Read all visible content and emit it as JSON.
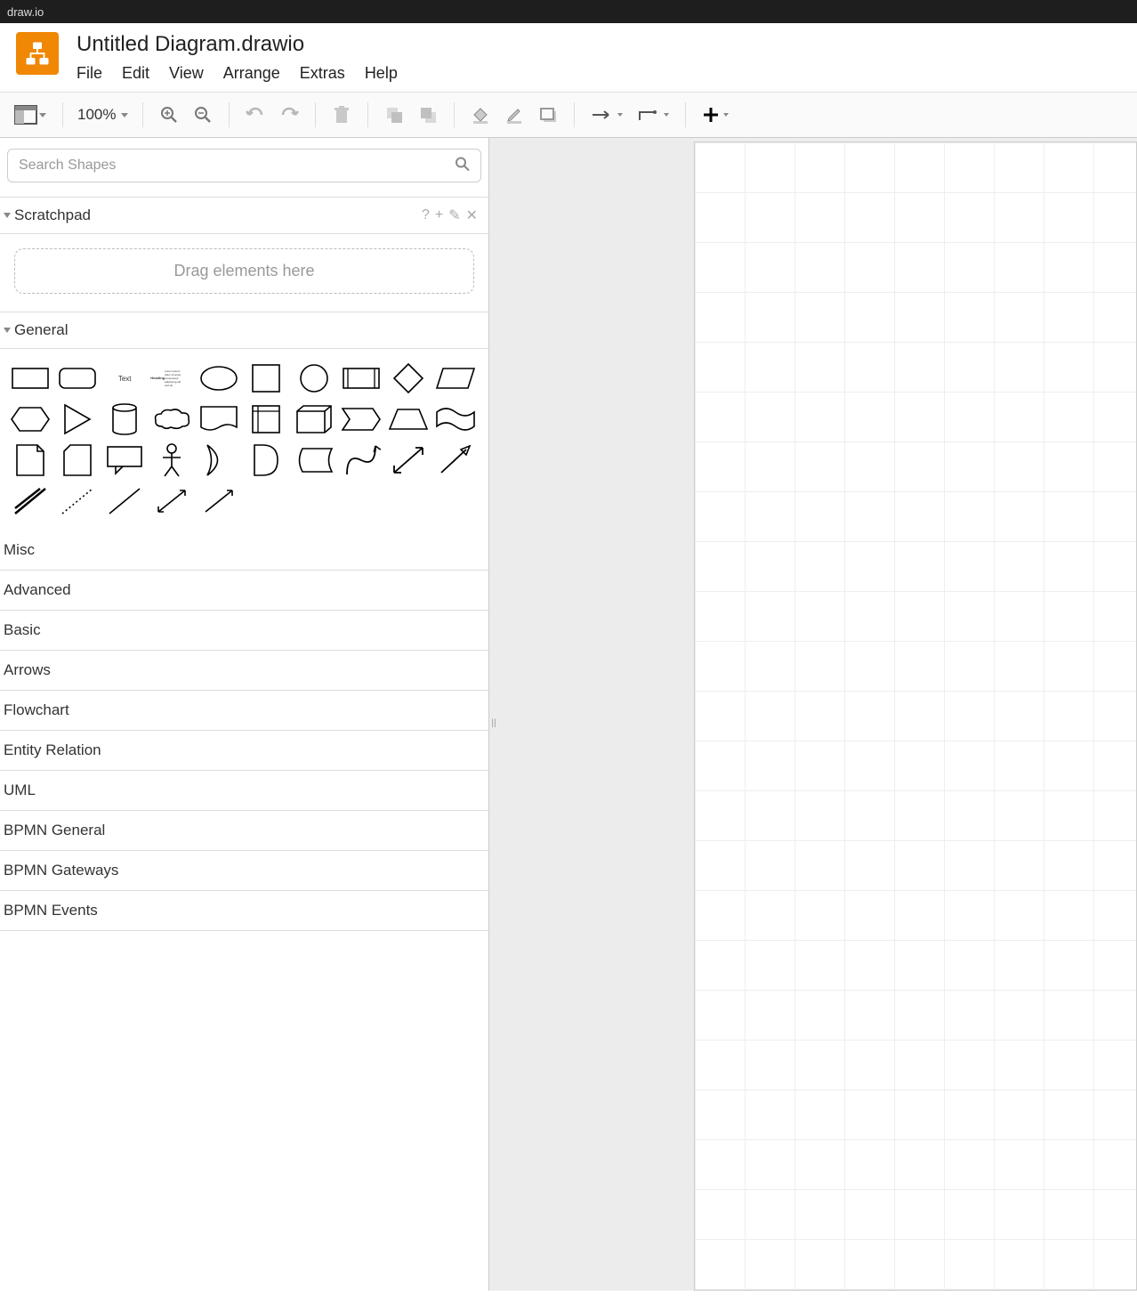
{
  "app_title": "draw.io",
  "doc_title": "Untitled Diagram.drawio",
  "menu": [
    "File",
    "Edit",
    "View",
    "Arrange",
    "Extras",
    "Help"
  ],
  "toolbar": {
    "zoom": "100%"
  },
  "search": {
    "placeholder": "Search Shapes"
  },
  "scratchpad": {
    "title": "Scratchpad",
    "drop_hint": "Drag elements here"
  },
  "general": {
    "title": "General",
    "text_label": "Text",
    "heading_label": "Heading"
  },
  "categories": [
    "Misc",
    "Advanced",
    "Basic",
    "Arrows",
    "Flowchart",
    "Entity Relation",
    "UML",
    "BPMN General",
    "BPMN Gateways",
    "BPMN Events"
  ]
}
